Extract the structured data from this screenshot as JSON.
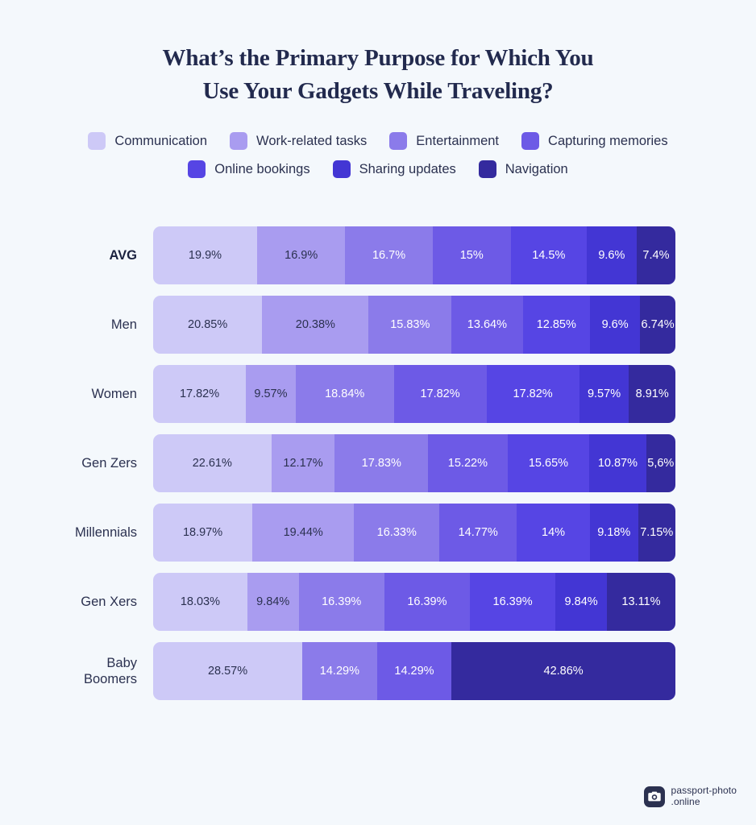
{
  "title": {
    "line1": "What’s the Primary Purpose for Which You",
    "line2": "Use Your Gadgets While Traveling?"
  },
  "legend": {
    "rows": [
      [
        {
          "label": "Communication",
          "color": "#cdc9f7"
        },
        {
          "label": "Work-related tasks",
          "color": "#a99cf0"
        },
        {
          "label": "Entertainment",
          "color": "#8b7bea"
        },
        {
          "label": "Capturing memories",
          "color": "#6d5ae6"
        }
      ],
      [
        {
          "label": "Online bookings",
          "color": "#5645e4"
        },
        {
          "label": "Sharing updates",
          "color": "#4336d4"
        },
        {
          "label": "Navigation",
          "color": "#342a9e"
        }
      ]
    ]
  },
  "footer": {
    "logo_icon": "camera-icon",
    "name_line1": "passport-photo",
    "name_line2": ".online"
  },
  "chart_data": {
    "type": "bar",
    "subtype": "stacked-horizontal-100",
    "title": "What’s the Primary Purpose for Which You Use Your Gadgets While Traveling?",
    "xlabel": "",
    "ylabel": "",
    "unit": "percent",
    "xlim": [
      0,
      100
    ],
    "grid": false,
    "legend_position": "top",
    "categories": [
      "AVG",
      "Men",
      "Women",
      "Gen Zers",
      "Millennials",
      "Gen Xers",
      "Baby Boomers"
    ],
    "series": [
      {
        "name": "Communication",
        "color": "#cdc9f7",
        "text_color": "#2b3150",
        "values": [
          19.9,
          20.85,
          17.82,
          22.61,
          18.97,
          18.03,
          28.57
        ],
        "labels": [
          "19.9%",
          "20.85%",
          "17.82%",
          "22.61%",
          "18.97%",
          "18.03%",
          "28.57%"
        ]
      },
      {
        "name": "Work-related tasks",
        "color": "#a99cf0",
        "text_color": "#2b3150",
        "values": [
          16.9,
          20.38,
          9.57,
          12.17,
          19.44,
          9.84,
          0
        ],
        "labels": [
          "16.9%",
          "20.38%",
          "9.57%",
          "12.17%",
          "19.44%",
          "9.84%",
          ""
        ]
      },
      {
        "name": "Entertainment",
        "color": "#8b7bea",
        "text_color": "#ffffff",
        "values": [
          16.7,
          15.83,
          18.84,
          17.83,
          16.33,
          16.39,
          14.29
        ],
        "labels": [
          "16.7%",
          "15.83%",
          "18.84%",
          "17.83%",
          "16.33%",
          "16.39%",
          "14.29%"
        ]
      },
      {
        "name": "Capturing memories",
        "color": "#6d5ae6",
        "text_color": "#ffffff",
        "values": [
          15,
          13.64,
          17.82,
          15.22,
          14.77,
          16.39,
          14.29
        ],
        "labels": [
          "15%",
          "13.64%",
          "17.82%",
          "15.22%",
          "14.77%",
          "16.39%",
          "14.29%"
        ]
      },
      {
        "name": "Online bookings",
        "color": "#5645e4",
        "text_color": "#ffffff",
        "values": [
          14.5,
          12.85,
          17.82,
          15.65,
          14,
          16.39,
          0
        ],
        "labels": [
          "14.5%",
          "12.85%",
          "17.82%",
          "15.65%",
          "14%",
          "16.39%",
          ""
        ]
      },
      {
        "name": "Sharing updates",
        "color": "#4336d4",
        "text_color": "#ffffff",
        "values": [
          9.6,
          9.6,
          9.57,
          10.87,
          9.18,
          9.84,
          0
        ],
        "labels": [
          "9.6%",
          "9.6%",
          "9.57%",
          "10.87%",
          "9.18%",
          "9.84%",
          ""
        ]
      },
      {
        "name": "Navigation",
        "color": "#342a9e",
        "text_color": "#ffffff",
        "values": [
          7.4,
          6.74,
          8.91,
          5.6,
          7.15,
          13.11,
          42.86
        ],
        "labels": [
          "7.4%",
          "6.74%",
          "8.91%",
          "5,6%",
          "7.15%",
          "13.11%",
          "42.86%"
        ]
      }
    ]
  }
}
